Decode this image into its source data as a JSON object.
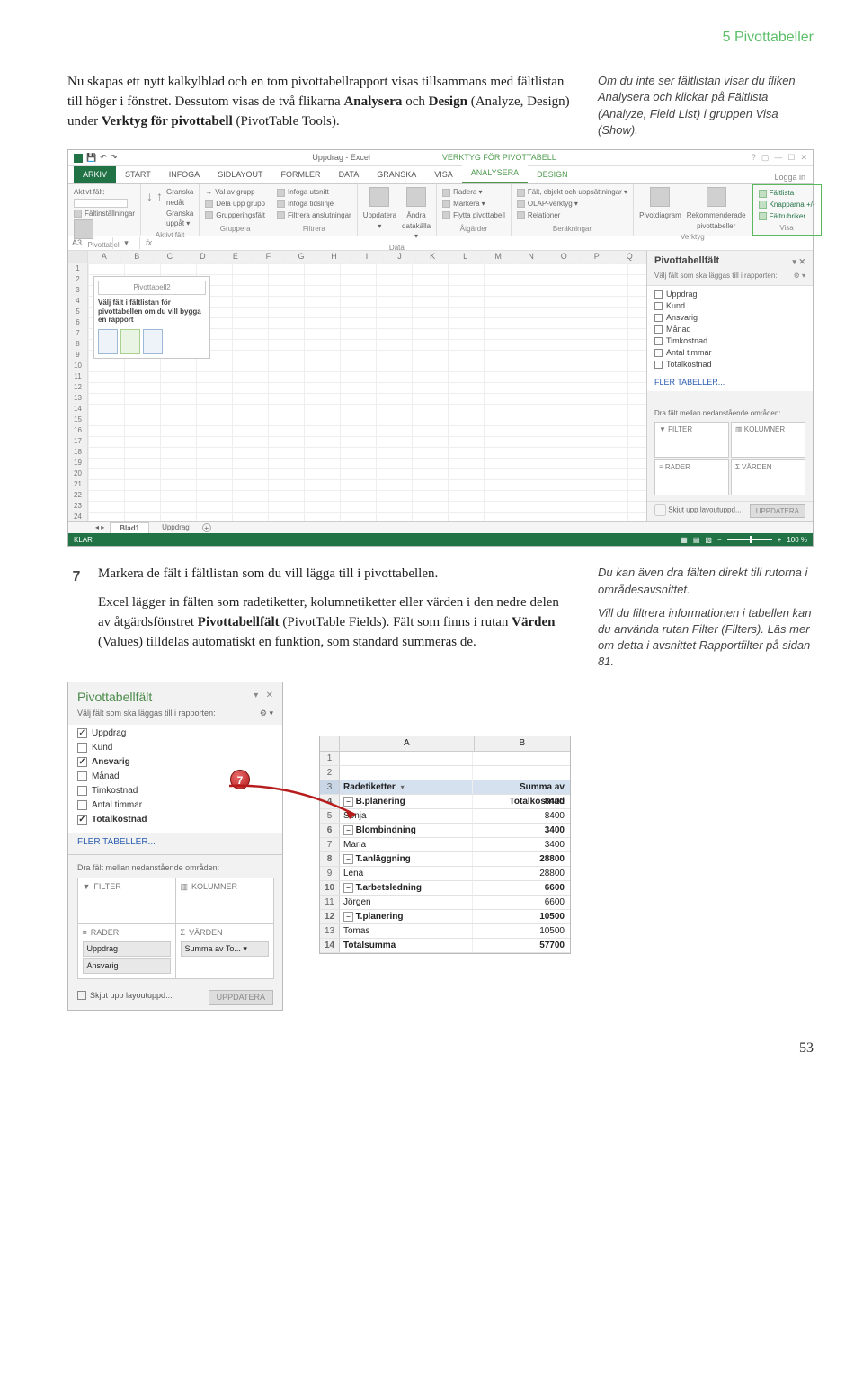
{
  "header": {
    "chapter": "5  Pivottabeller"
  },
  "intro": {
    "p1a": "Nu skapas ett nytt kalkylblad och en tom pivottabellrapport visas tillsammans med fältlistan till höger i fönstret. Dessutom visas de två flikarna ",
    "p1b": "Analysera",
    "p1c": " och ",
    "p1d": "Design",
    "p1e": " (Analyze, Design) under ",
    "p1f": "Verktyg för pivottabell",
    "p1g": " (PivotTable Tools)."
  },
  "sidenote1": "Om du inte ser fältlistan visar du fliken Analysera och klickar på Fältlista (Analyze, Field List) i gruppen Visa (Show).",
  "excel1": {
    "title_left": "Uppdrag - Excel",
    "title_right": "VERKTYG FÖR PIVOTTABELL",
    "login": "Logga in",
    "tabs": [
      "ARKIV",
      "START",
      "INFOGA",
      "SIDLAYOUT",
      "FORMLER",
      "DATA",
      "GRANSKA",
      "VISA",
      "ANALYSERA",
      "DESIGN"
    ],
    "ribbon": {
      "g1": {
        "name": "Pivottabell",
        "items": [
          "Aktivt fält:",
          "",
          "Fältinställningar"
        ]
      },
      "g2": {
        "name": "Aktivt fält",
        "items": [
          "Granska nedåt",
          "Granska uppåt ▾"
        ]
      },
      "g3": {
        "name": "Gruppera",
        "items": [
          "Val av grupp",
          "Dela upp grupp",
          "Grupperingsfält"
        ]
      },
      "g4": {
        "name": "Filtrera",
        "items": [
          "Infoga utsnitt",
          "Infoga tidslinje",
          "Filtrera anslutningar"
        ]
      },
      "g5": {
        "name": "Data",
        "items": [
          "Uppdatera ▾",
          "Ändra datakälla ▾"
        ]
      },
      "g6": {
        "name": "Åtgärder",
        "items": [
          "Radera ▾",
          "Markera ▾",
          "Flytta pivottabell"
        ]
      },
      "g7": {
        "name": "Beräkningar",
        "items": [
          "Fält, objekt och uppsättningar ▾",
          "OLAP-verktyg ▾",
          "Relationer"
        ]
      },
      "g8": {
        "name": "Verktyg",
        "items": [
          "Pivotdiagram",
          "Rekommenderade pivottabeller"
        ]
      },
      "g9": {
        "name": "Visa",
        "items": [
          "Fältlista",
          "Knapparna +/-",
          "Fältrubriker"
        ]
      }
    },
    "namebox": "A3",
    "cols": [
      "A",
      "B",
      "C",
      "D",
      "E",
      "F",
      "G",
      "H",
      "I",
      "J",
      "K",
      "L",
      "M",
      "N",
      "O",
      "P",
      "Q"
    ],
    "placeholder": {
      "title": "Pivottabell2",
      "text": "Välj fält i fältlistan för pivottabellen om du vill bygga en rapport"
    },
    "fieldpane": {
      "title": "Pivottabellfält",
      "sub": "Välj fält som ska läggas till i rapporten:",
      "fields": [
        "Uppdrag",
        "Kund",
        "Ansvarig",
        "Månad",
        "Timkostnad",
        "Antal timmar",
        "Totalkostnad"
      ],
      "more": "FLER TABELLER...",
      "areahdr": "Dra fält mellan nedanstående områden:",
      "filter": "FILTER",
      "kolumner": "KOLUMNER",
      "rader": "RADER",
      "varden": "VÄRDEN",
      "defer": "Skjut upp layoutuppd...",
      "update": "UPPDATERA"
    },
    "sheets": [
      "Blad1",
      "Uppdrag"
    ],
    "status": "KLAR",
    "zoom": "100 %"
  },
  "step7": {
    "num": "7",
    "p1": "Markera de fält i fältlistan som du vill lägga till i pivottabellen.",
    "p2a": "Excel lägger in fälten som radetiketter, kolumnetiketter eller värden i den nedre delen av åtgärdsfönstret ",
    "p2b": "Pivottabellfält",
    "p2c": " (PivotTable Fields). Fält som finns i rutan ",
    "p2d": "Värden",
    "p2e": " (Values) tilldelas automatiskt en funktion, som standard summeras de."
  },
  "sidenote2": {
    "p1": "Du kan även dra fälten direkt till rutorna i områdesavsnittet.",
    "p2": "Vill du filtrera informationen i tabellen kan du använda rutan Filter (Filters). Läs mer om detta i avsnittet Rapportfilter på sidan 81."
  },
  "figpane": {
    "title": "Pivottabellfält",
    "sub": "Välj fält som ska läggas till i rapporten:",
    "fields": [
      {
        "label": "Uppdrag",
        "checked": true,
        "bold": false
      },
      {
        "label": "Kund",
        "checked": false,
        "bold": false
      },
      {
        "label": "Ansvarig",
        "checked": true,
        "bold": true
      },
      {
        "label": "Månad",
        "checked": false,
        "bold": false
      },
      {
        "label": "Timkostnad",
        "checked": false,
        "bold": false
      },
      {
        "label": "Antal timmar",
        "checked": false,
        "bold": false
      },
      {
        "label": "Totalkostnad",
        "checked": true,
        "bold": true
      }
    ],
    "more": "FLER TABELLER...",
    "areahdr": "Dra fält mellan nedanstående områden:",
    "filter": "FILTER",
    "kolumner": "KOLUMNER",
    "rader": "RADER",
    "varden": "VÄRDEN",
    "rader_items": [
      "Uppdrag",
      "Ansvarig"
    ],
    "varden_items": [
      "Summa av To... ▾"
    ],
    "defer": "Skjut upp layoutuppd...",
    "update": "UPPDATERA",
    "badge": "7"
  },
  "result": {
    "colA": "A",
    "colB": "B",
    "rows": [
      {
        "n": "1",
        "a": "",
        "b": ""
      },
      {
        "n": "2",
        "a": "",
        "b": ""
      },
      {
        "n": "3",
        "a": "Radetiketter",
        "b": "Summa av Totalkostnad",
        "hdr": true,
        "sel": true
      },
      {
        "n": "4",
        "a": "B.planering",
        "b": "8400",
        "exp": true,
        "bold": true
      },
      {
        "n": "5",
        "a": "    Sonja",
        "b": "8400"
      },
      {
        "n": "6",
        "a": "Blombindning",
        "b": "3400",
        "exp": true,
        "bold": true
      },
      {
        "n": "7",
        "a": "    Maria",
        "b": "3400"
      },
      {
        "n": "8",
        "a": "T.anläggning",
        "b": "28800",
        "exp": true,
        "bold": true
      },
      {
        "n": "9",
        "a": "    Lena",
        "b": "28800"
      },
      {
        "n": "10",
        "a": "T.arbetsledning",
        "b": "6600",
        "exp": true,
        "bold": true
      },
      {
        "n": "11",
        "a": "    Jörgen",
        "b": "6600"
      },
      {
        "n": "12",
        "a": "T.planering",
        "b": "10500",
        "exp": true,
        "bold": true
      },
      {
        "n": "13",
        "a": "    Tomas",
        "b": "10500"
      },
      {
        "n": "14",
        "a": "Totalsumma",
        "b": "57700",
        "bold": true
      }
    ]
  },
  "page_num": "53"
}
